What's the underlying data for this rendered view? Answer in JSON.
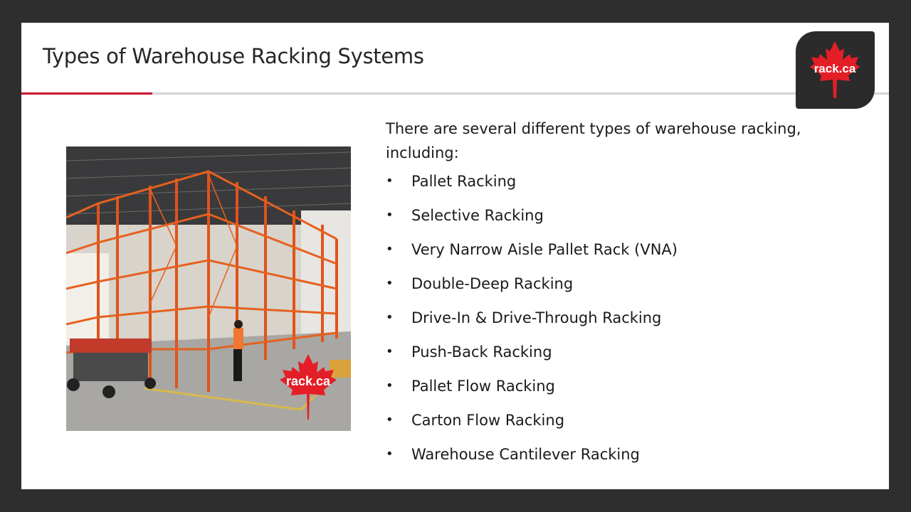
{
  "slide": {
    "title": "Types of Warehouse Racking Systems",
    "logo_text": "rack.ca",
    "accent_color": "#c8102e",
    "photo": {
      "description": "Warehouse with orange pallet racking, scissor lift and worker",
      "watermark_text": "rack.ca"
    },
    "intro": "There are several different types of warehouse racking, including:",
    "bullet_glyph": "•",
    "items": [
      "Pallet Racking",
      "Selective Racking",
      "Very Narrow Aisle Pallet Rack (VNA)",
      "Double-Deep Racking",
      "Drive-In & Drive-Through Racking",
      "Push-Back Racking",
      "Pallet Flow Racking",
      "Carton Flow Racking",
      "Warehouse Cantilever Racking"
    ]
  }
}
